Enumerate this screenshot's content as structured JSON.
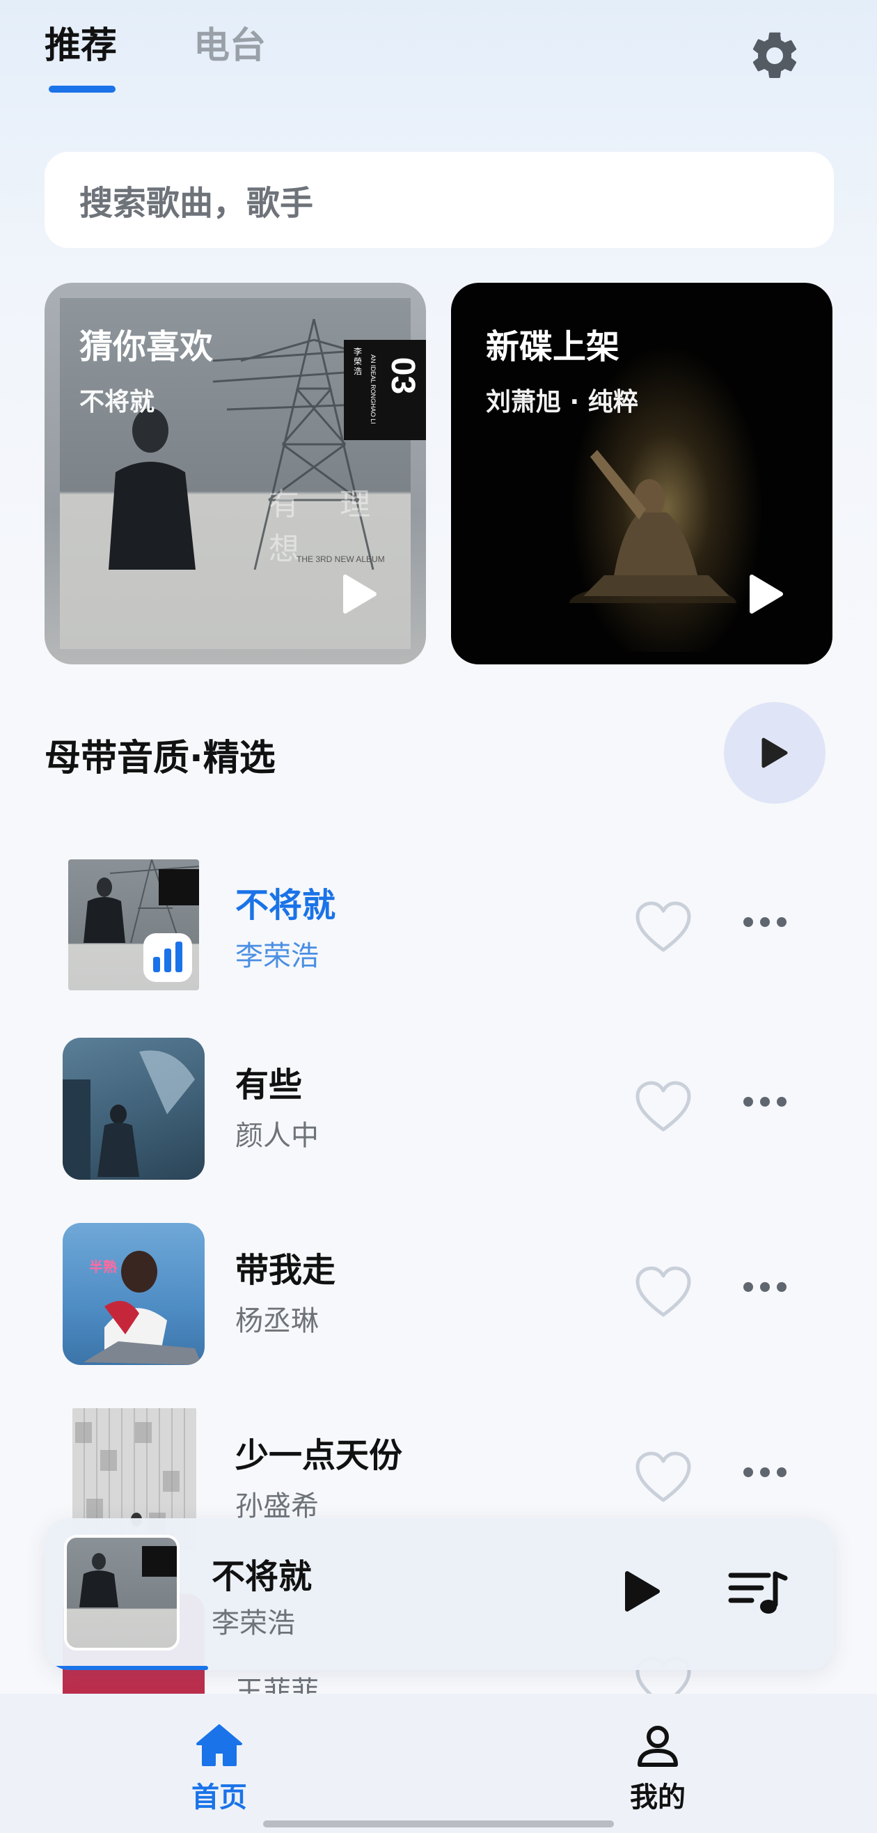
{
  "tabs": [
    {
      "label": "推荐",
      "active": true
    },
    {
      "label": "电台",
      "active": false
    }
  ],
  "icons": {
    "settings": "gear-icon",
    "play": "play-icon",
    "heart": "heart-icon",
    "more": "more-icon",
    "queue": "playlist-icon",
    "home": "home-icon",
    "profile": "person-icon"
  },
  "search": {
    "placeholder": "搜索歌曲，歌手"
  },
  "cards": [
    {
      "title": "猜你喜欢",
      "subtitle": "不将就",
      "cover_text": "有 理 想",
      "cover_caption": "THE 3RD NEW ALBUM",
      "cover_number": "03",
      "cover_side_text": "AN IDEAL RONGHAO LI",
      "cover_artist": "李榮浩"
    },
    {
      "title": "新碟上架",
      "subtitle": "刘萧旭 · 纯粹"
    }
  ],
  "section": {
    "title": "母带音质·精选"
  },
  "songs": [
    {
      "title": "不将就",
      "artist": "李荣浩",
      "playing": true
    },
    {
      "title": "有些",
      "artist": "颜人中",
      "playing": false
    },
    {
      "title": "带我走",
      "artist": "杨丞琳",
      "playing": false
    },
    {
      "title": "少一点天份",
      "artist": "孙盛希",
      "playing": false
    }
  ],
  "partial_row_artist": "王菲菲",
  "mini_player": {
    "title": "不将就",
    "artist": "李荣浩",
    "progress": 0.2
  },
  "nav": [
    {
      "label": "首页",
      "active": true
    },
    {
      "label": "我的",
      "active": false
    }
  ],
  "colors": {
    "accent": "#1a73e8",
    "background": "#f7f8fb"
  }
}
